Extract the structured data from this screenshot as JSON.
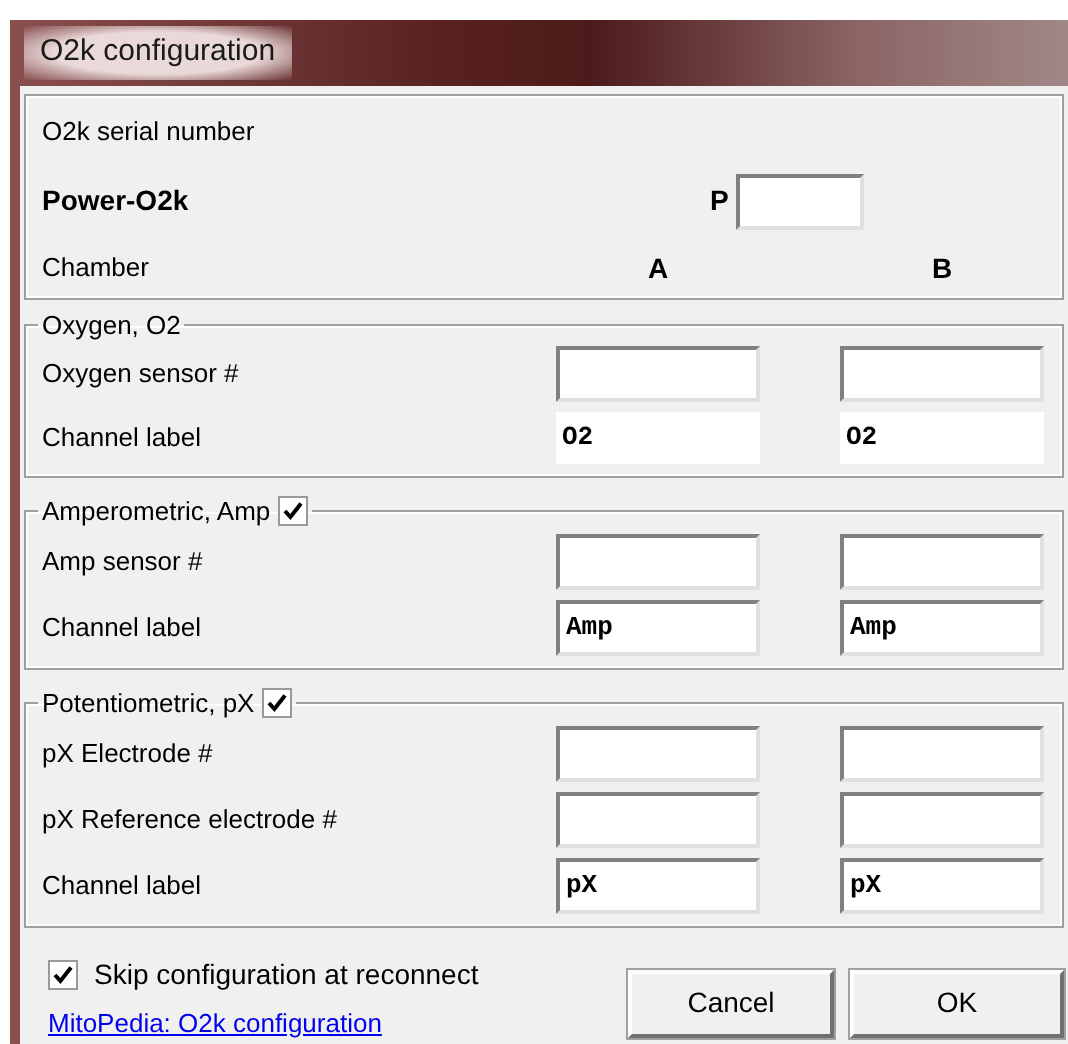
{
  "window": {
    "title": "O2k configuration"
  },
  "header": {
    "serial_label": "O2k serial number",
    "model": "Power-O2k",
    "prefix": "P",
    "chamber_label": "Chamber",
    "chambers": [
      "A",
      "B"
    ]
  },
  "groups": [
    {
      "title": "Oxygen, O2",
      "rows": [
        {
          "label": "Oxygen sensor #",
          "fields": [
            {
              "kind": "edit"
            },
            {
              "kind": "edit"
            }
          ]
        },
        {
          "label": "Channel label",
          "fields": [
            {
              "kind": "readonly",
              "value": "O2"
            },
            {
              "kind": "readonly",
              "value": "O2"
            }
          ]
        }
      ]
    },
    {
      "title": "Amperometric, Amp",
      "checked": true,
      "rows": [
        {
          "label": "Amp sensor #",
          "fields": [
            {
              "kind": "edit"
            },
            {
              "kind": "edit"
            }
          ]
        },
        {
          "label": "Channel label",
          "fields": [
            {
              "kind": "edit",
              "value": "Amp"
            },
            {
              "kind": "edit",
              "value": "Amp"
            }
          ]
        }
      ]
    },
    {
      "title": "Potentiometric, pX",
      "checked": true,
      "rows": [
        {
          "label": "pX Electrode #",
          "fields": [
            {
              "kind": "edit"
            },
            {
              "kind": "edit"
            }
          ]
        },
        {
          "label": "pX Reference electrode #",
          "fields": [
            {
              "kind": "edit"
            },
            {
              "kind": "edit"
            }
          ]
        },
        {
          "label": "Channel label",
          "fields": [
            {
              "kind": "edit",
              "value": "pX"
            },
            {
              "kind": "edit",
              "value": "pX"
            }
          ]
        }
      ]
    }
  ],
  "footer": {
    "skip_label": "Skip configuration at reconnect",
    "skip_checked": true,
    "link": "MitoPedia: O2k configuration",
    "buttons": [
      "Cancel",
      "OK"
    ]
  }
}
